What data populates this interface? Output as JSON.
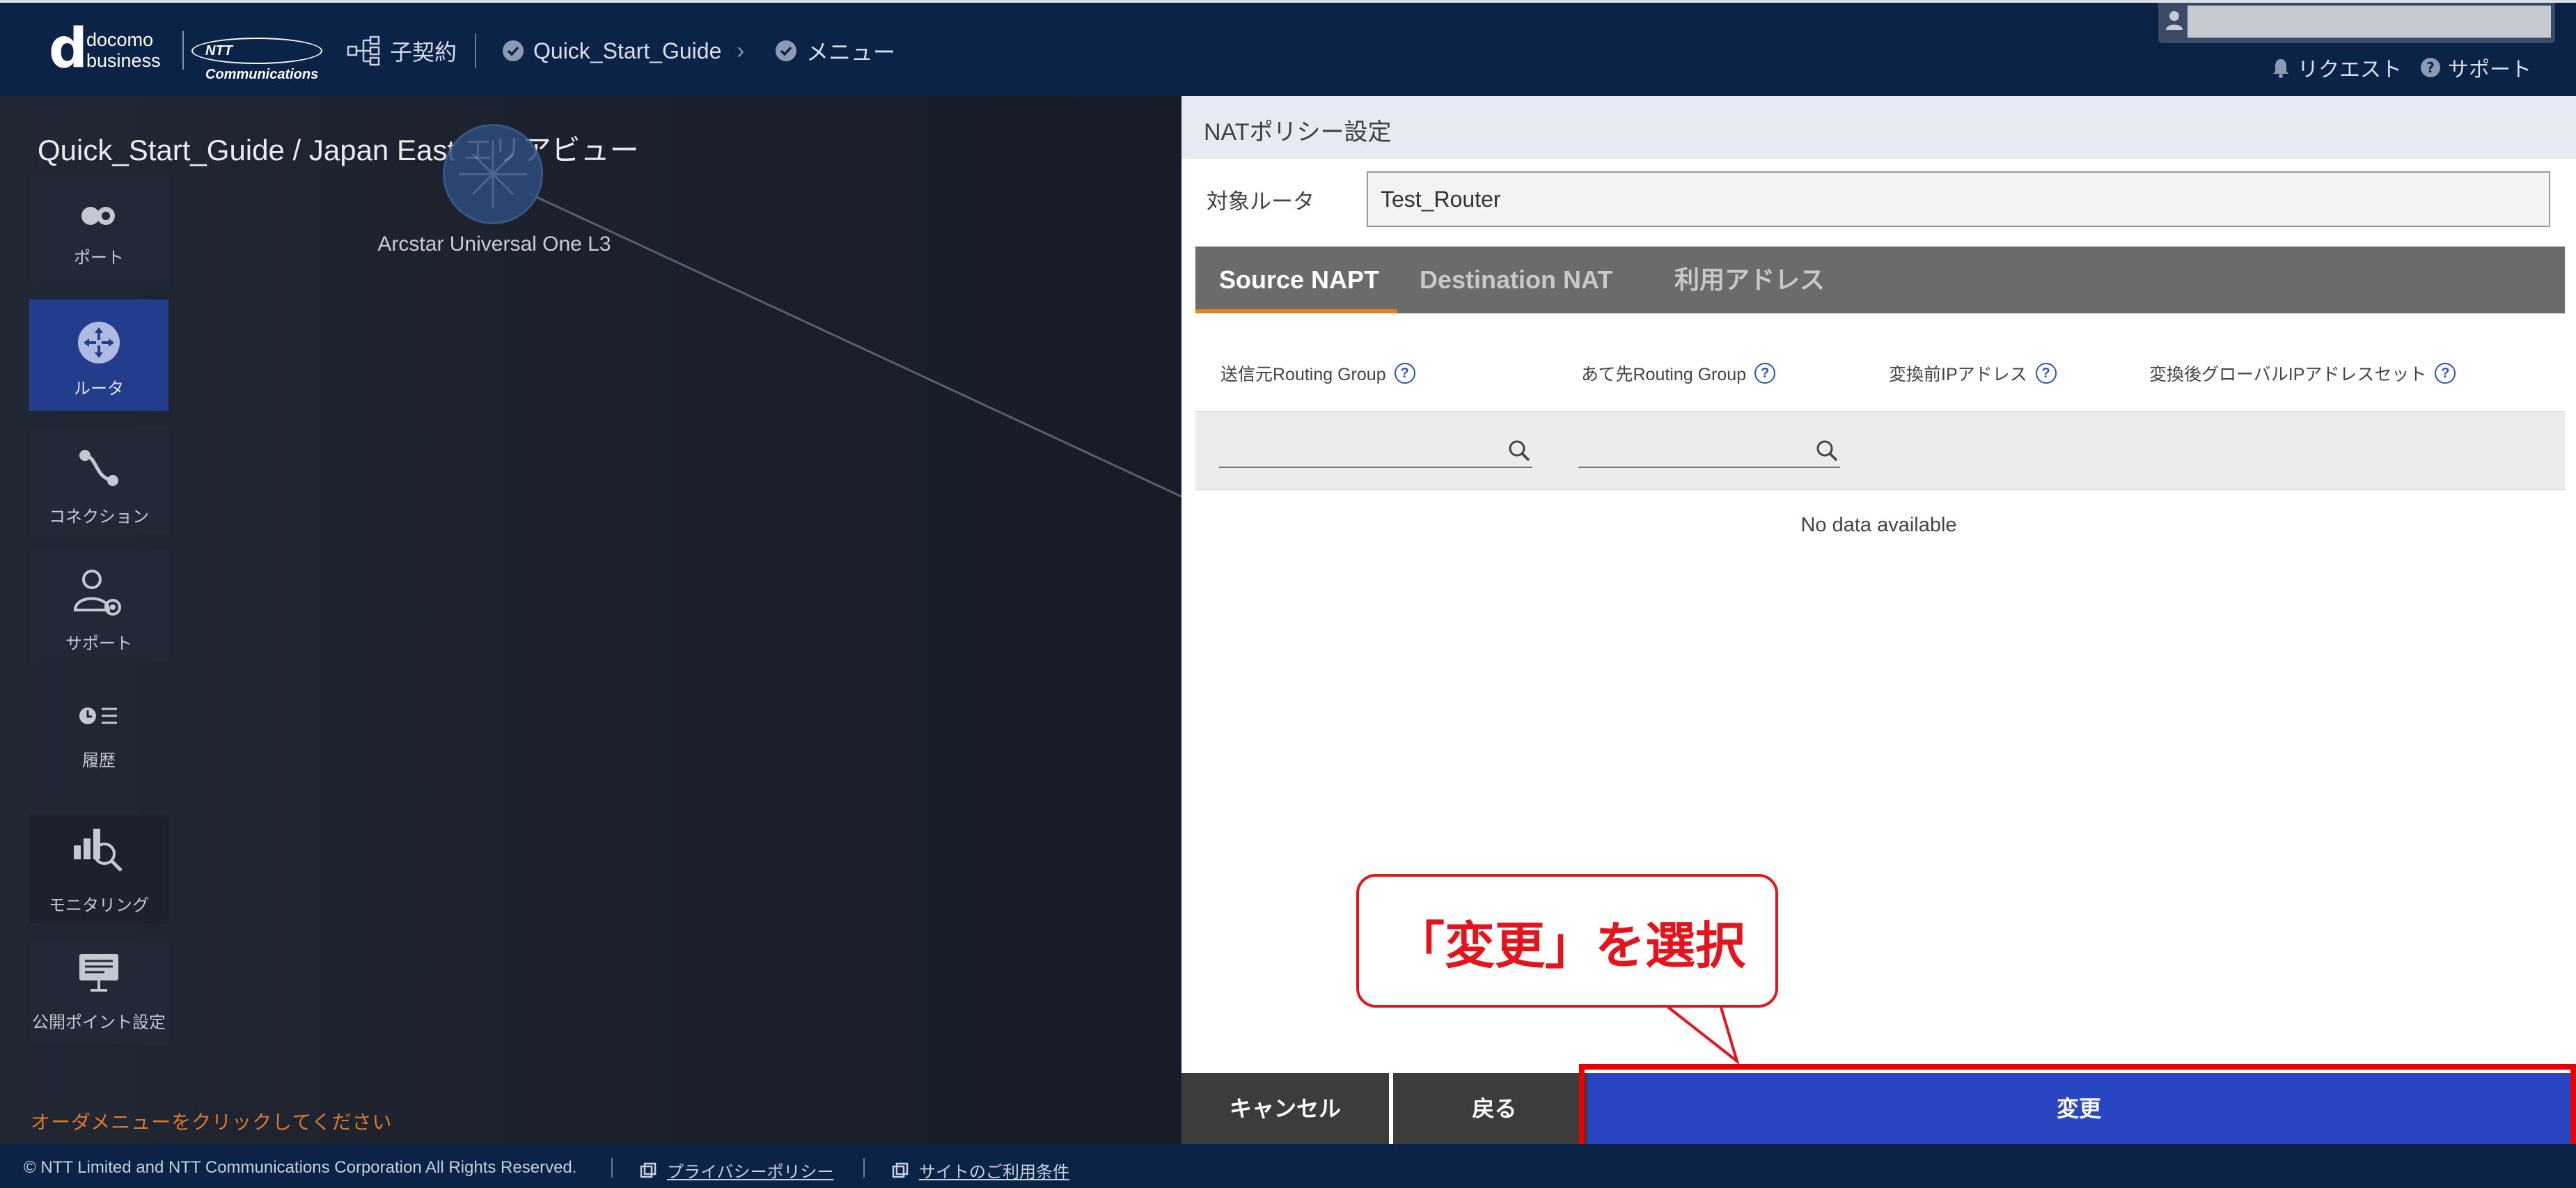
{
  "header": {
    "brand_docomo": "docomo",
    "brand_business": "business",
    "brand_ntt": "NTT Communications",
    "contract_label": "子契約",
    "breadcrumb_guide": "Quick_Start_Guide",
    "breadcrumb_menu": "メニュー",
    "request_label": "リクエスト",
    "support_label": "サポート"
  },
  "canvas": {
    "area_title": "Quick_Start_Guide / Japan East エリアビュー",
    "node_label": "Arcstar Universal One L3",
    "order_hint": "オーダメニューをクリックしてください"
  },
  "sidebar": {
    "items": [
      {
        "label": "ポート",
        "icon": "port-icon"
      },
      {
        "label": "ルータ",
        "icon": "router-icon",
        "active": true
      },
      {
        "label": "コネクション",
        "icon": "connection-icon"
      },
      {
        "label": "サポート",
        "icon": "support-icon"
      },
      {
        "label": "履歴",
        "icon": "history-icon"
      },
      {
        "label": "モニタリング",
        "icon": "monitoring-icon"
      },
      {
        "label": "公開ポイント設定",
        "icon": "public-point-icon"
      }
    ]
  },
  "panel": {
    "title": "NATポリシー設定",
    "router_label": "対象ルータ",
    "router_value": "Test_Router",
    "tabs": [
      "Source NAPT",
      "Destination NAT",
      "利用アドレス"
    ],
    "active_tab": "Source NAPT",
    "columns": [
      "送信元Routing Group",
      "あて先Routing Group",
      "変換前IPアドレス",
      "変換後グローバルIPアドレスセット"
    ],
    "help_glyph": "?",
    "no_data": "No data available"
  },
  "callout": {
    "text": "「変更」を選択"
  },
  "buttons": {
    "cancel": "キャンセル",
    "back": "戻る",
    "change": "変更"
  },
  "footer": {
    "copyright": "© NTT Limited and NTT Communications Corporation All Rights Reserved.",
    "privacy": "プライバシーポリシー",
    "terms": "サイトのご利用条件"
  },
  "colors": {
    "header_bg": "#0c2348",
    "accent_blue": "#2a45c1",
    "tab_underline": "#e1821f",
    "callout_red": "#e3141b",
    "order_hint": "#e0782a"
  }
}
